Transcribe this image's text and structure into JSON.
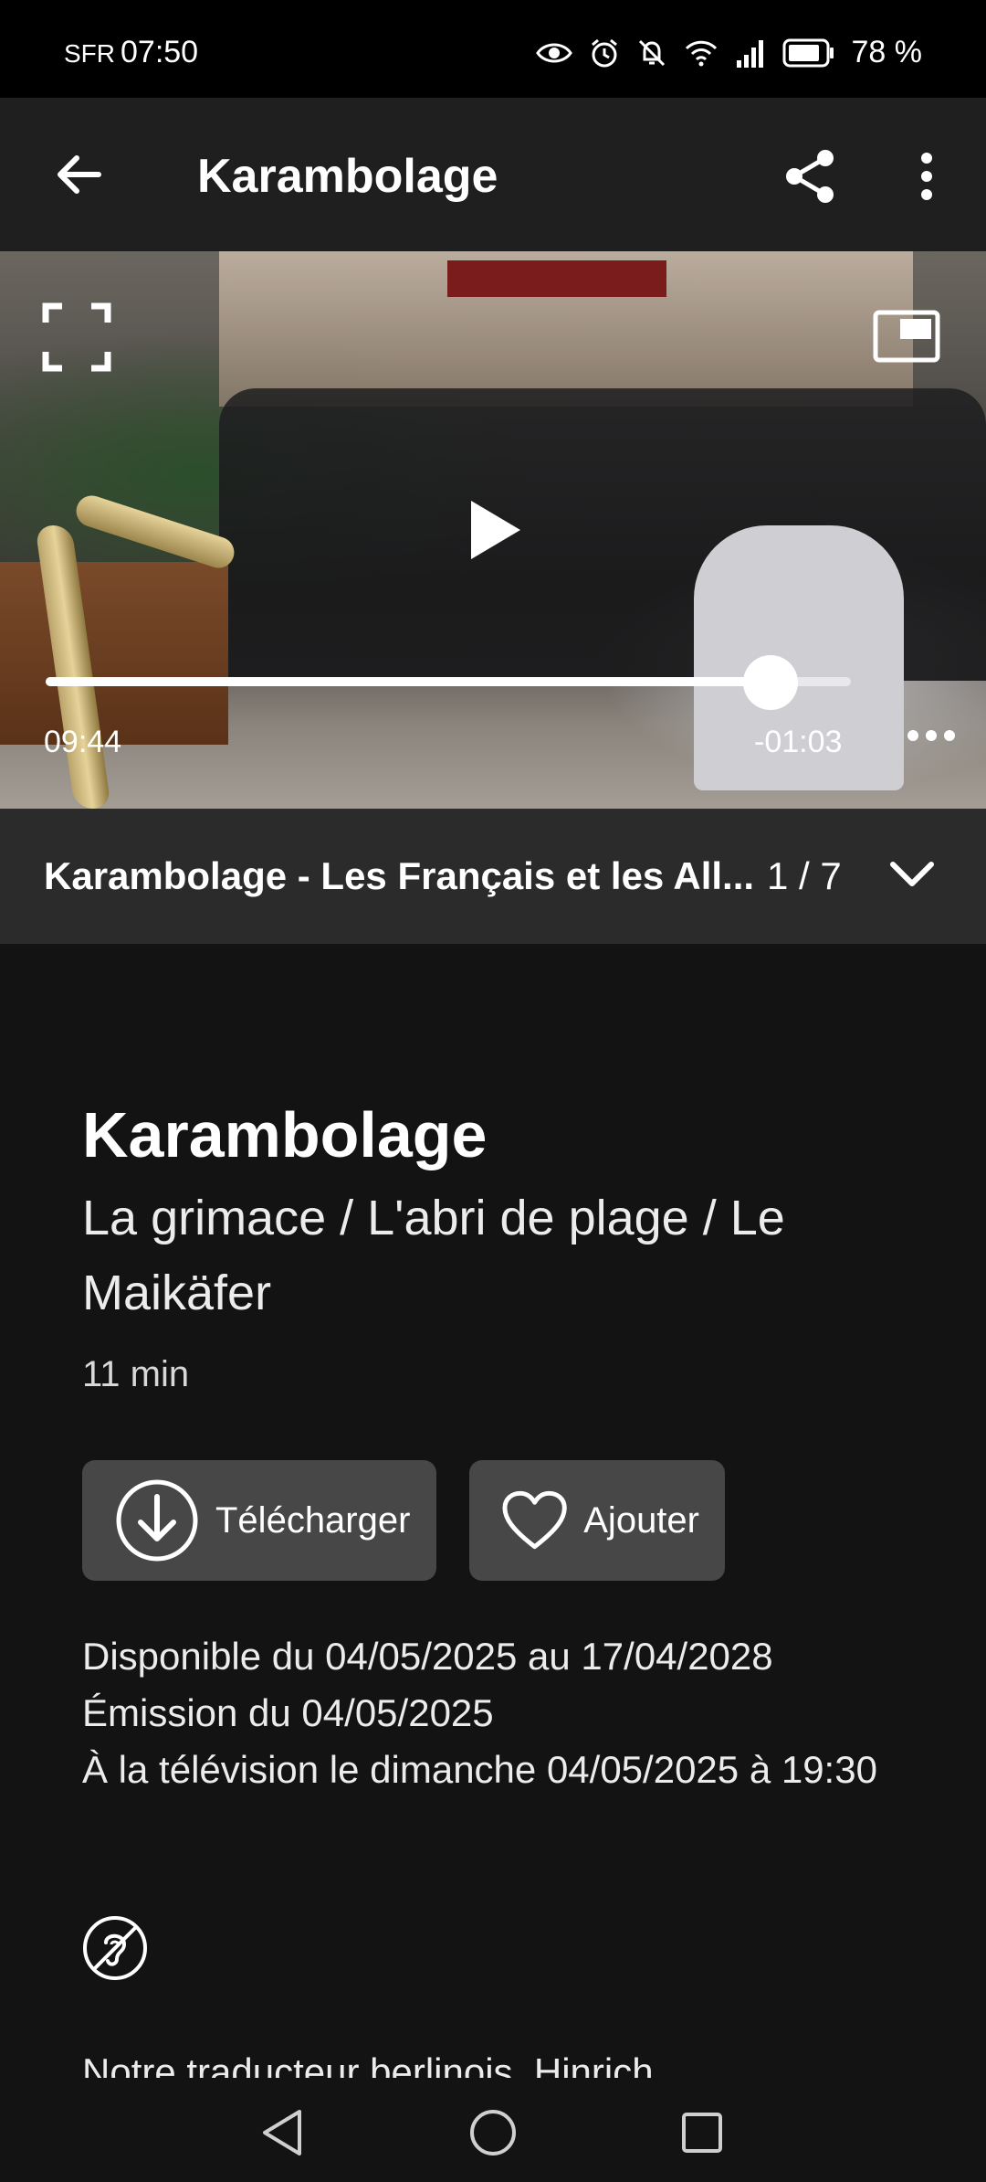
{
  "status_bar": {
    "carrier": "SFR",
    "time": "07:50",
    "battery": "78 %",
    "icons": [
      "eye-icon",
      "alarm-icon",
      "mute-icon",
      "wifi-icon",
      "signal-icon",
      "battery-icon"
    ]
  },
  "app_bar": {
    "title": "Karambolage",
    "back_icon": "arrow-left-icon",
    "share_icon": "share-icon",
    "more_icon": "more-vertical-icon"
  },
  "player": {
    "elapsed": "09:44",
    "remaining": "-01:03",
    "progress": 0.9,
    "icons": [
      "fullscreen-icon",
      "picture-in-picture-icon",
      "play-icon",
      "more-horizontal-icon"
    ]
  },
  "playlist": {
    "title": "Karambolage - Les Français et les All...",
    "count": "1 / 7",
    "expand_icon": "chevron-down-icon"
  },
  "program": {
    "title": "Karambolage",
    "subtitle": "La grimace / L'abri de plage / Le Maikäfer",
    "duration": "11 min"
  },
  "actions": {
    "download_label": "Télécharger",
    "add_label": "Ajouter"
  },
  "availability": {
    "line1": "Disponible du 04/05/2025 au 17/04/2028",
    "line2": "Émission du 04/05/2025",
    "line3": "À la télévision le dimanche 04/05/2025 à 19:30"
  },
  "description": {
    "text": "Notre traducteur berlinois, Hinrich"
  },
  "colors": {
    "background": "#131313",
    "app_bar": "#1f1f1f",
    "playlist_bar": "#2b2b2b",
    "button": "#474747"
  }
}
